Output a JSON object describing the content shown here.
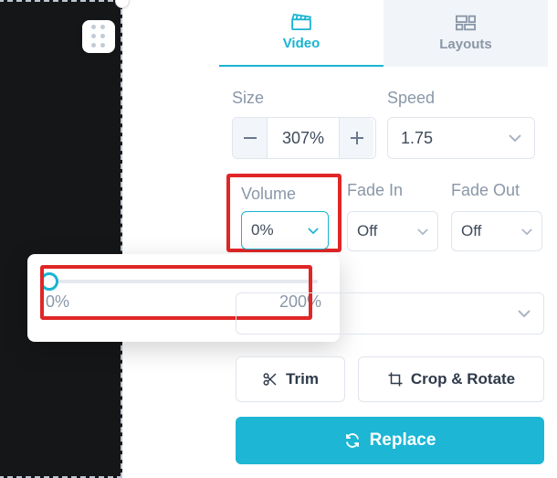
{
  "tabs": {
    "video": "Video",
    "layouts": "Layouts"
  },
  "size": {
    "label": "Size",
    "value": "307%"
  },
  "speed": {
    "label": "Speed",
    "value": "1.75"
  },
  "volume": {
    "label": "Volume",
    "value": "0%"
  },
  "fadeIn": {
    "label": "Fade In",
    "value": "Off"
  },
  "fadeOut": {
    "label": "Fade Out",
    "value": "Off"
  },
  "slider": {
    "min": "0%",
    "max": "200%"
  },
  "buttons": {
    "trim": "Trim",
    "crop": "Crop & Rotate",
    "replace": "Replace"
  }
}
